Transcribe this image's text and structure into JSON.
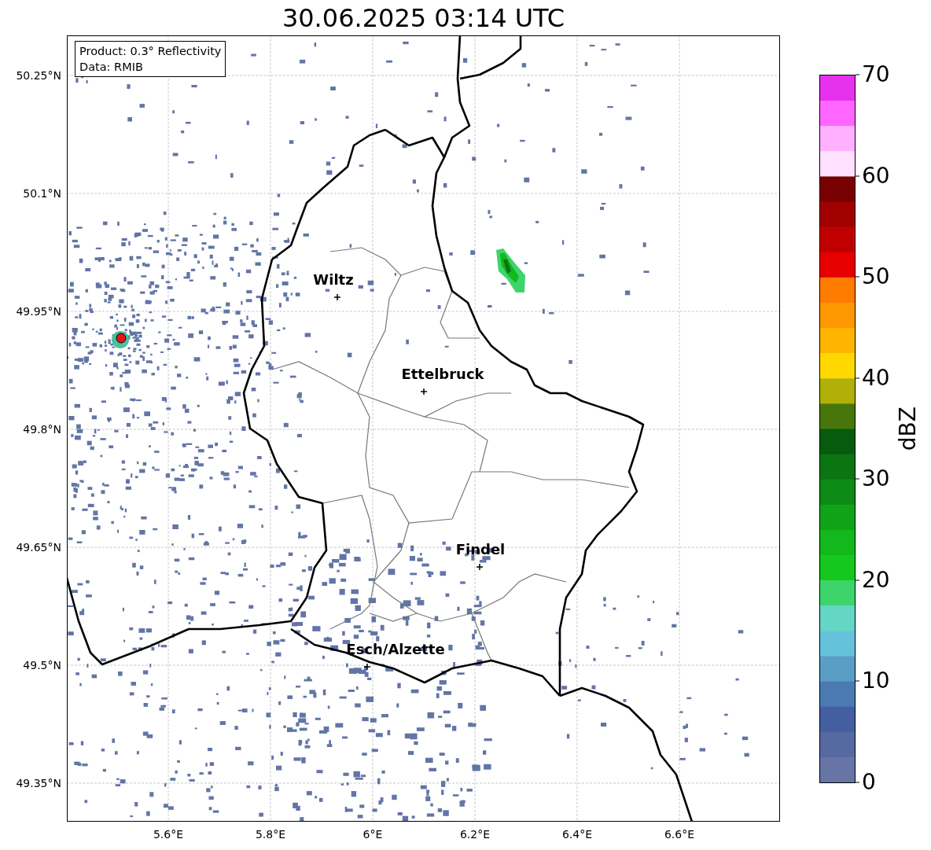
{
  "title": "30.06.2025 03:14 UTC",
  "map": {
    "info_box": [
      "Product: 0.3° Reflectivity",
      "Data: RMIB"
    ],
    "lat_ticks": [
      "50.25°N",
      "50.1°N",
      "49.95°N",
      "49.8°N",
      "49.65°N",
      "49.5°N",
      "49.35°N"
    ],
    "lon_ticks": [
      "5.6°E",
      "5.8°E",
      "6°E",
      "6.2°E",
      "6.4°E",
      "6.6°E"
    ],
    "places": [
      {
        "name": "Wiltz"
      },
      {
        "name": "Ettelbruck"
      },
      {
        "name": "Findel"
      },
      {
        "name": "Esch/Alzette"
      }
    ]
  },
  "colorbar": {
    "label": "dBZ",
    "ticks": [
      "70",
      "60",
      "50",
      "40",
      "30",
      "20",
      "10",
      "0"
    ],
    "segments": [
      {
        "color": "#e632ee"
      },
      {
        "color": "#ff66ff"
      },
      {
        "color": "#ffb0ff"
      },
      {
        "color": "#ffe0ff"
      },
      {
        "color": "#780000"
      },
      {
        "color": "#a00000"
      },
      {
        "color": "#c00000"
      },
      {
        "color": "#e60000"
      },
      {
        "color": "#ff7c00"
      },
      {
        "color": "#ff9800"
      },
      {
        "color": "#ffb400"
      },
      {
        "color": "#ffd800"
      },
      {
        "color": "#b0b008"
      },
      {
        "color": "#47760c"
      },
      {
        "color": "#065c0c"
      },
      {
        "color": "#0b7512"
      },
      {
        "color": "#0e8a16"
      },
      {
        "color": "#10a318"
      },
      {
        "color": "#12b81c"
      },
      {
        "color": "#14c81e"
      },
      {
        "color": "#3dd46c"
      },
      {
        "color": "#64d6c4"
      },
      {
        "color": "#66c1db"
      },
      {
        "color": "#5a9ec6"
      },
      {
        "color": "#4b7ab3"
      },
      {
        "color": "#445fa1"
      },
      {
        "color": "#5669a1"
      },
      {
        "color": "#6674a6"
      }
    ]
  }
}
